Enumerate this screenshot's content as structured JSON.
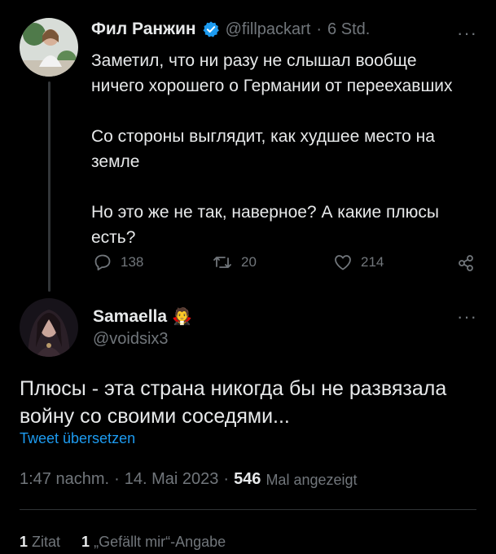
{
  "tweet1": {
    "name": "Фил Ранжин",
    "handle": "@fillpackart",
    "separator": "·",
    "time": "6 Std.",
    "text": "Заметил, что ни разу не слышал вообще\nничего хорошего о Германии от переехавших\n\nСо стороны выглядит, как худшее место на\nземле\n\nНо это же не так, наверное? А какие плюсы\nесть?",
    "replies": "138",
    "retweets": "20",
    "likes": "214",
    "more": "···"
  },
  "reply": {
    "name": "Samaella",
    "name_emoji": "🧛",
    "handle": "@voidsix3",
    "more": "···",
    "text": "Плюсы - эта страна никогда бы не развязала\nвойну со своими соседями...",
    "translate": "Tweet übersetzen",
    "time": "1:47 nachm.",
    "date": "14. Mai 2023",
    "views_count": "546",
    "views_label": "Mal angezeigt",
    "separator": "·"
  },
  "stats": {
    "quotes_count": "1",
    "quotes_label": "Zitat",
    "likes_count": "1",
    "likes_label": "„Gefällt mir“-Angabe"
  },
  "colors": {
    "background": "#000000",
    "text": "#e7e9ea",
    "muted": "#71767b",
    "link": "#1d9bf0",
    "verified": "#1d9bf0",
    "divider": "#2f3336"
  }
}
